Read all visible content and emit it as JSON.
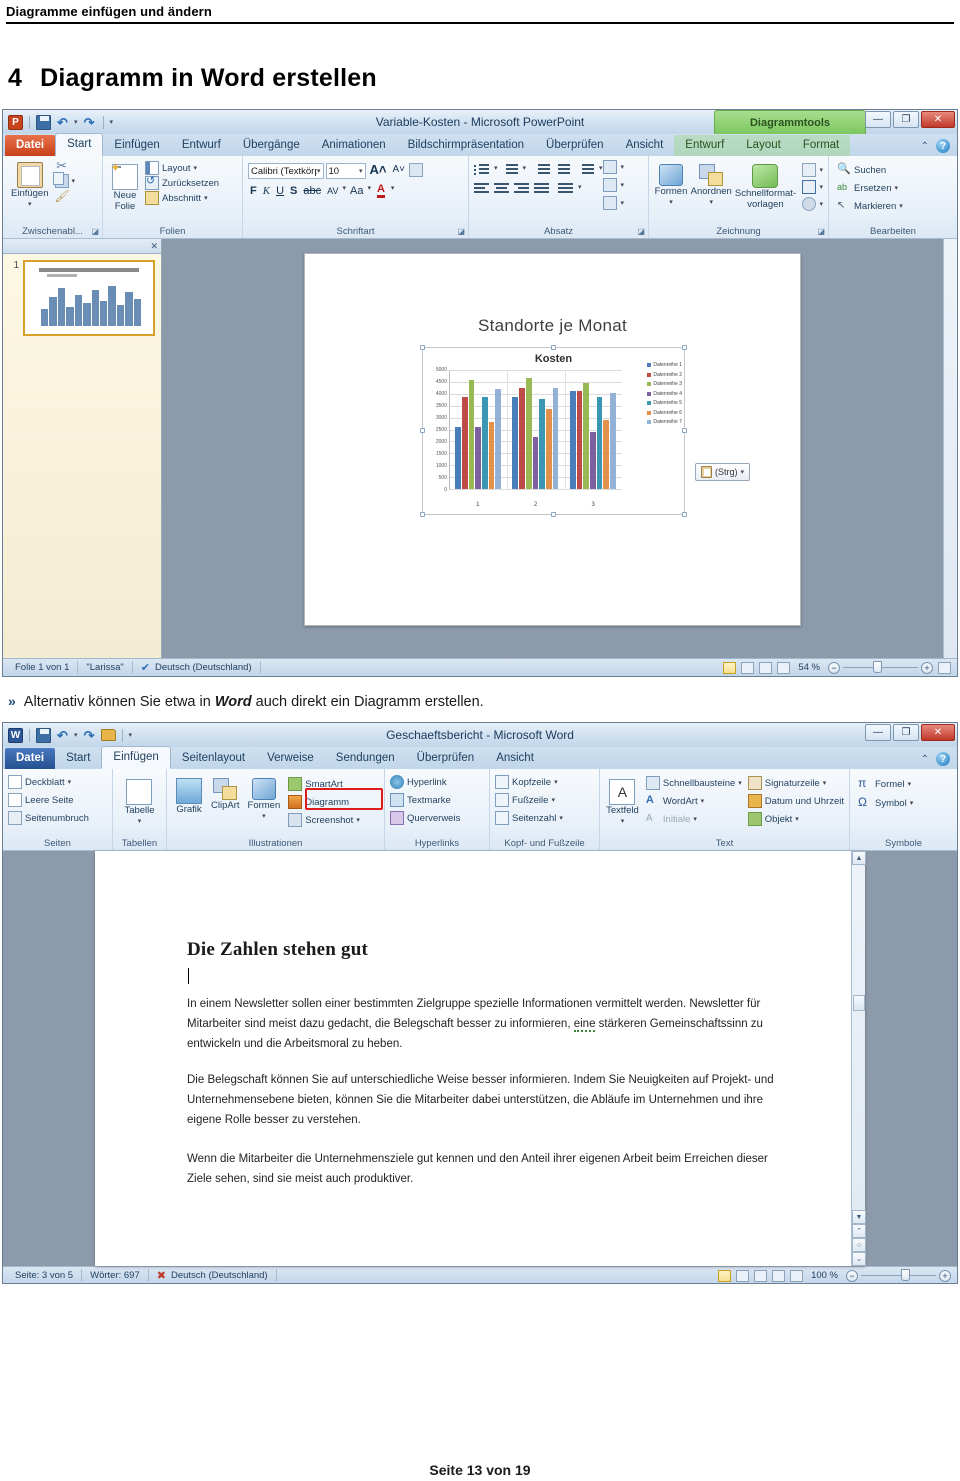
{
  "doc": {
    "header": "Diagramme einfügen und ändern",
    "section_number": "4",
    "section_title": "Diagramm in Word erstellen",
    "mid_chevron": "»",
    "mid_text_1": "Alternativ können Sie etwa in ",
    "mid_text_em": "Word",
    "mid_text_2": " auch direkt ein Diagramm erstellen.",
    "footer": "Seite 13 von 19"
  },
  "powerpoint": {
    "app_badge": "P",
    "title": "Variable-Kosten  -  Microsoft PowerPoint",
    "qat": [
      "save-icon",
      "undo-icon",
      "redo-icon",
      "customize-qat-icon"
    ],
    "window_buttons": {
      "minimize": "—",
      "restore": "❐",
      "close": "✕"
    },
    "contextual_banner": "Diagrammtools",
    "tabs": [
      {
        "label": "Datei",
        "type": "file"
      },
      {
        "label": "Start",
        "type": "active"
      },
      {
        "label": "Einfügen",
        "type": "normal"
      },
      {
        "label": "Entwurf",
        "type": "normal"
      },
      {
        "label": "Übergänge",
        "type": "normal"
      },
      {
        "label": "Animationen",
        "type": "normal"
      },
      {
        "label": "Bildschirmpräsentation",
        "type": "normal"
      },
      {
        "label": "Überprüfen",
        "type": "normal"
      },
      {
        "label": "Ansicht",
        "type": "normal"
      }
    ],
    "ctx_tabs": [
      {
        "label": "Entwurf"
      },
      {
        "label": "Layout"
      },
      {
        "label": "Format"
      }
    ],
    "ribbon": {
      "clipboard": {
        "group_label": "Zwischenabl...",
        "paste": "Einfügen",
        "cut": "cut-icon",
        "copy": "copy-icon",
        "format_painter": "format-painter-icon"
      },
      "slides": {
        "group_label": "Folien",
        "new_slide": "Neue\nFolie",
        "new_slide_l1": "Neue",
        "new_slide_l2": "Folie",
        "layout": "Layout",
        "reset": "Zurücksetzen",
        "section": "Abschnitt"
      },
      "font": {
        "group_label": "Schriftart",
        "font_name": "Calibri (Textkörpe",
        "font_size": "10",
        "grow": "A",
        "shrink": "A",
        "clear_format": "clear-format-icon",
        "bold": "F",
        "italic": "K",
        "underline": "U",
        "shadow": "S",
        "strike": "abc",
        "spacing": "AV",
        "change_case": "Aa",
        "font_color": "A"
      },
      "paragraph": {
        "group_label": "Absatz"
      },
      "drawing": {
        "group_label": "Zeichnung",
        "shapes": "Formen",
        "arrange": "Anordnen",
        "quick_styles_l1": "Schnellformat-",
        "quick_styles_l2": "vorlagen"
      },
      "editing": {
        "group_label": "Bearbeiten",
        "find": "Suchen",
        "replace": "Ersetzen",
        "select": "Markieren"
      }
    },
    "slide": {
      "thumb_number": "1",
      "title": "Standorte je Monat"
    },
    "paste_options": {
      "label": "(Strg)",
      "icon": "clipboard-icon"
    },
    "status": {
      "slide_info": "Folie 1 von 1",
      "theme": "\"Larissa\"",
      "language": "Deutsch (Deutschland)",
      "spellcheck_icon": "spellcheck-icon",
      "zoom": "54 %",
      "zoom_out": "−",
      "zoom_in": "+",
      "fit_icon": "fit-slide-icon"
    }
  },
  "word": {
    "app_badge": "W",
    "title": "Geschaeftsbericht  -  Microsoft Word",
    "window_buttons": {
      "minimize": "—",
      "restore": "❐",
      "close": "✕"
    },
    "tabs": [
      {
        "label": "Datei",
        "type": "file"
      },
      {
        "label": "Start",
        "type": "normal"
      },
      {
        "label": "Einfügen",
        "type": "active"
      },
      {
        "label": "Seitenlayout",
        "type": "normal"
      },
      {
        "label": "Verweise",
        "type": "normal"
      },
      {
        "label": "Sendungen",
        "type": "normal"
      },
      {
        "label": "Überprüfen",
        "type": "normal"
      },
      {
        "label": "Ansicht",
        "type": "normal"
      }
    ],
    "ribbon": {
      "pages": {
        "group_label": "Seiten",
        "cover": "Deckblatt",
        "blank": "Leere Seite",
        "break": "Seitenumbruch"
      },
      "tables": {
        "group_label": "Tabellen",
        "table": "Tabelle"
      },
      "illustrations": {
        "group_label": "Illustrationen",
        "picture": "Grafik",
        "clipart": "ClipArt",
        "shapes": "Formen",
        "smartart": "SmartArt",
        "chart": "Diagramm",
        "screenshot": "Screenshot"
      },
      "links": {
        "group_label": "Hyperlinks",
        "hyperlink": "Hyperlink",
        "bookmark": "Textmarke",
        "crossref": "Querverweis"
      },
      "headerfooter": {
        "group_label": "Kopf- und Fußzeile",
        "header": "Kopfzeile",
        "footer": "Fußzeile",
        "pagenum": "Seitenzahl"
      },
      "text": {
        "group_label": "Text",
        "textbox": "Textfeld",
        "quickparts": "Schnellbausteine",
        "wordart": "WordArt",
        "dropcap": "Initiale",
        "signature": "Signaturzeile",
        "datetime": "Datum und Uhrzeit",
        "object": "Objekt"
      },
      "symbols": {
        "group_label": "Symbole",
        "equation": "Formel",
        "symbol": "Symbol",
        "equation_glyph": "π",
        "symbol_glyph": "Ω"
      }
    },
    "document": {
      "heading": "Die Zahlen stehen gut",
      "p1_a": "In einem Newsletter sollen einer bestimmten Zielgruppe spezielle Informationen vermittelt werden. Newsletter für Mitarbeiter sind meist dazu gedacht, die Belegschaft besser zu informieren, ",
      "p1_underlined": "eine",
      "p1_b": " stärkeren Gemeinschaftssinn zu entwickeln und die Arbeitsmoral zu heben.",
      "p2": "Die Belegschaft können Sie auf unterschiedliche Weise besser informieren. Indem Sie Neuigkeiten auf Projekt- und Unternehmensebene bieten, können Sie die Mitarbeiter dabei unterstützen, die Abläufe im Unternehmen und ihre eigene Rolle besser zu verstehen.",
      "p3": "Wenn die Mitarbeiter die Unternehmensziele gut kennen und den Anteil ihrer eigenen Arbeit beim Erreichen dieser Ziele sehen, sind sie meist auch produktiver."
    },
    "status": {
      "page_info": "Seite: 3 von 5",
      "words": "Wörter: 697",
      "language": "Deutsch (Deutschland)",
      "spellcheck_icon": "spellcheck-error-icon",
      "zoom": "100 %",
      "zoom_out": "−",
      "zoom_in": "+"
    }
  },
  "colors": {
    "ppt_accent": "#c9441d",
    "word_accent": "#2b5797",
    "contextual_green": "#7cc75f",
    "highlight_red": "#e01b1b"
  },
  "chart_data": {
    "type": "bar",
    "title": "Kosten",
    "xlabel": "",
    "ylabel": "",
    "ylim": [
      0,
      5000
    ],
    "yticks": [
      0,
      500,
      1000,
      1500,
      2000,
      2500,
      3000,
      3500,
      4000,
      4500,
      5000
    ],
    "grid": true,
    "legend_position": "right",
    "categories": [
      "1",
      "2",
      "3"
    ],
    "series": [
      {
        "name": "Datenreihe 1",
        "color": "#4a7ebb",
        "values": [
          2600,
          3850,
          4100
        ]
      },
      {
        "name": "Datenreihe 2",
        "color": "#be4b48",
        "values": [
          3850,
          4250,
          4100
        ]
      },
      {
        "name": "Datenreihe 3",
        "color": "#98b954",
        "values": [
          4600,
          4650,
          4450
        ]
      },
      {
        "name": "Datenreihe 4",
        "color": "#7d60a0",
        "values": [
          2600,
          2200,
          2400
        ]
      },
      {
        "name": "Datenreihe 5",
        "color": "#3b96b4",
        "values": [
          3850,
          3800,
          3850
        ]
      },
      {
        "name": "Datenreihe 6",
        "color": "#e2914a",
        "values": [
          2800,
          3350,
          2900
        ]
      },
      {
        "name": "Datenreihe 7",
        "color": "#93b2d6",
        "values": [
          4200,
          4250,
          4050
        ]
      }
    ]
  }
}
